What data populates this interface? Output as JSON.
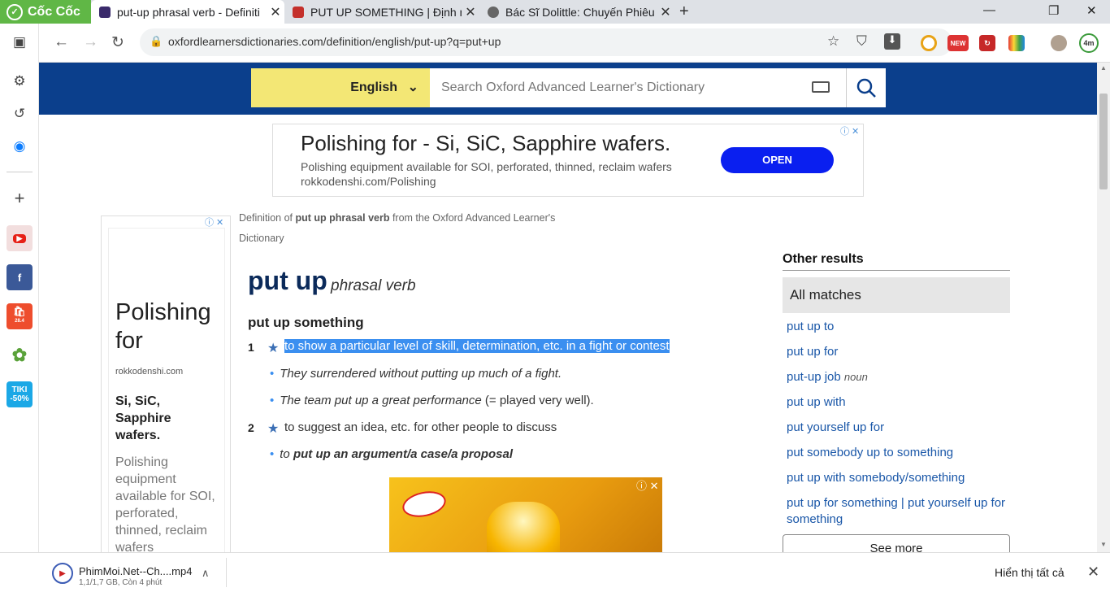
{
  "browser": {
    "brand": "Cốc Cốc",
    "tabs": [
      {
        "title": "put-up phrasal verb - Definiti",
        "active": true
      },
      {
        "title": "PUT UP SOMETHING | Định n",
        "active": false
      },
      {
        "title": "Bác Sĩ Dolittle: Chuyến Phiêu l",
        "active": false
      }
    ],
    "url": "oxfordlearnersdictionaries.com/definition/english/put-up?q=put+up",
    "sidebar_badge_shopee": "28.4",
    "sidebar_tiki_lines": [
      "TIKI",
      "-50%"
    ],
    "ext_new_label": "NEW",
    "avatar_label": "4m"
  },
  "site": {
    "language": "English",
    "search_placeholder": "Search Oxford Advanced Learner's Dictionary"
  },
  "top_ad": {
    "title": "Polishing for - Si, SiC, Sapphire wafers.",
    "line1": "Polishing equipment available for SOI, perforated, thinned, reclaim wafers",
    "line2": "rokkodenshi.com/Polishing",
    "button": "OPEN"
  },
  "side_ad": {
    "title": "Polishing for",
    "domain": "rokkodenshi.com",
    "subtitle": "Si, SiC, Sapphire wafers.",
    "body": "Polishing equipment available for SOI, perforated, thinned, reclaim wafers"
  },
  "entry": {
    "source_prefix": "Definition of ",
    "source_term": "put up phrasal verb",
    "source_suffix": " from the Oxford Advanced Learner's Dictionary",
    "headword": "put up",
    "pos": "phrasal verb",
    "phrasal": "put up something",
    "senses": [
      {
        "num": "1",
        "def": "to show a particular level of skill, determination, etc. in a fight or contest",
        "examples": [
          {
            "text": "They surrendered without putting up much of a fight."
          },
          {
            "text": "The team put up a great performance",
            "gloss": " (= played very well)."
          }
        ]
      },
      {
        "num": "2",
        "def": "to suggest an idea, etc. for other people to discuss",
        "examples": [
          {
            "pre": "to ",
            "bold": "put up an argument/a case/a proposal"
          }
        ]
      }
    ]
  },
  "sidebar_results": {
    "heading": "Other results",
    "all_matches": "All matches",
    "items": [
      {
        "text": "put up to"
      },
      {
        "text": "put up for"
      },
      {
        "text": "put-up job",
        "tag": "noun"
      },
      {
        "text": "put up with"
      },
      {
        "text": "put yourself up for"
      },
      {
        "text": "put somebody up to something"
      },
      {
        "text": "put up with somebody/something"
      },
      {
        "text": "put up for something | put yourself up for something"
      }
    ],
    "see_more": "See more"
  },
  "downloads": {
    "file": "PhimMoi.Net--Ch....mp4",
    "status": "1,1/1,7 GB, Còn 4 phút",
    "show_all": "Hiển thị tất cả"
  }
}
